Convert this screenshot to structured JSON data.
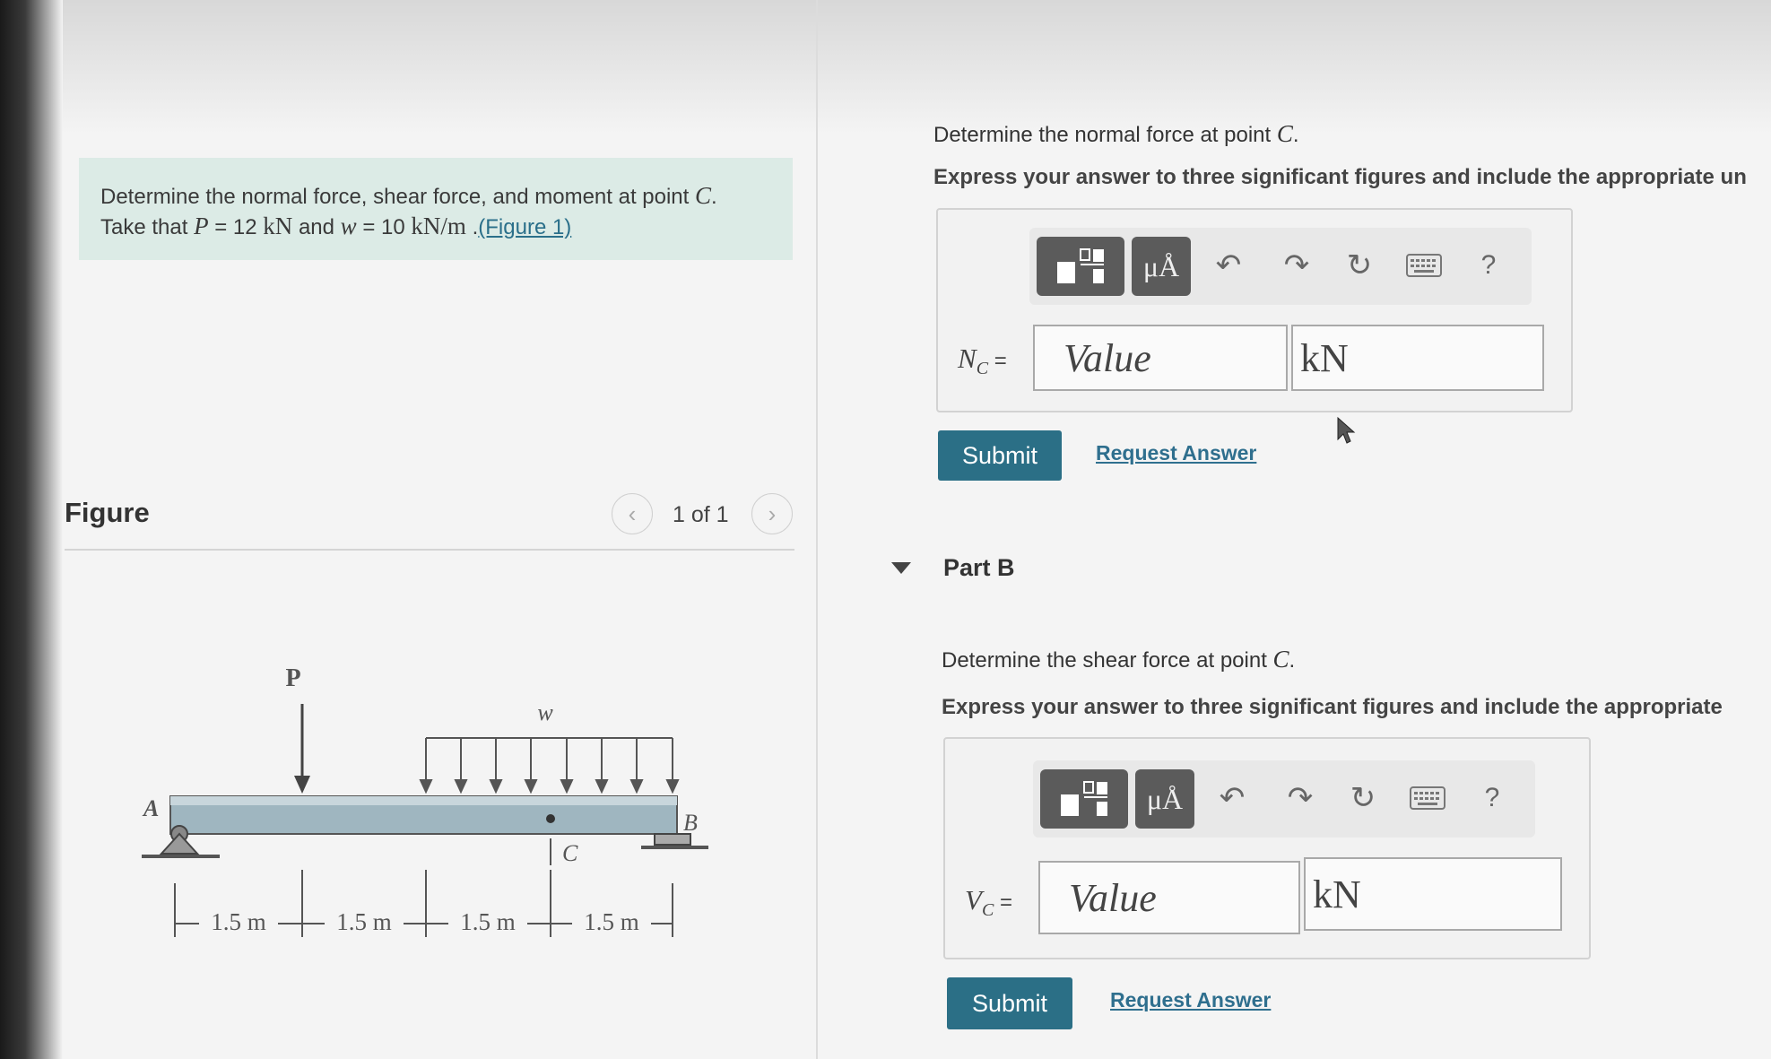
{
  "problem": {
    "line1": "Determine the normal force, shear force, and moment at point ",
    "point": "C",
    "line2_take": "Take that ",
    "P_sym": "P",
    "P_val": " = 12 ",
    "P_unit": "kN",
    "and": " and ",
    "w_sym": "w",
    "w_val": " = 10 ",
    "w_unit": "kN/m",
    "dot": " .",
    "figure_link": "(Figure 1)"
  },
  "figure": {
    "title": "Figure",
    "pager": "1 of 1",
    "labels": {
      "P": "P",
      "w": "w",
      "A": "A",
      "B": "B",
      "C": "C",
      "seg1": "1.5 m",
      "seg2": "1.5 m",
      "seg3": "1.5 m",
      "seg4": "1.5 m"
    }
  },
  "partA": {
    "question": "Determine the normal force at point ",
    "point": "C",
    "period": ".",
    "instruction": "Express your answer to three significant figures and include the appropriate un",
    "label_main": "N",
    "label_sub": "C",
    "equals": " =",
    "value_placeholder": "Value",
    "unit": "kN",
    "submit": "Submit",
    "request": "Request Answer"
  },
  "partB": {
    "header": "Part B",
    "question": "Determine the shear force at point ",
    "point": "C",
    "period": ".",
    "instruction": "Express your answer to three significant figures and include the appropriate",
    "label_main": "V",
    "label_sub": "C",
    "equals": " =",
    "value_placeholder": "Value",
    "unit": "kN",
    "submit": "Submit",
    "request": "Request Answer"
  },
  "toolbar": {
    "units_button": "μÅ",
    "help": "?"
  }
}
